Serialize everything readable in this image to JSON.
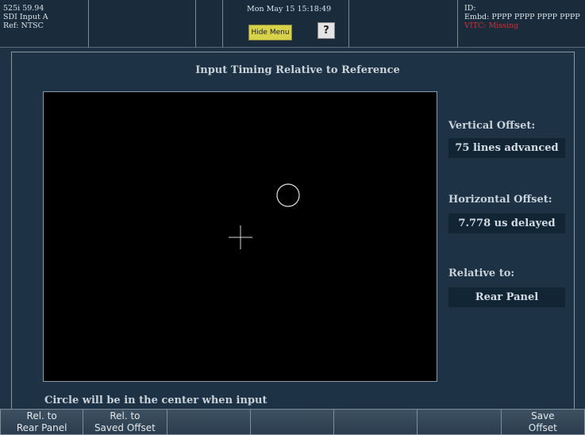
{
  "status_bar": {
    "format_line1": "525i 59.94",
    "format_line2": "SDI Input A",
    "format_line3": "Ref: NTSC",
    "datetime": "Mon May 15 15:18:49",
    "hide_menu_label": "Hide Menu",
    "help_label": "?",
    "id_label": "ID:",
    "embd_label": "Embd: PPPP PPPP PPPP PPPP",
    "vitc_label": "VITC:  Missing"
  },
  "panel": {
    "title": "Input Timing Relative to Reference",
    "vertical_offset_label": "Vertical Offset:",
    "vertical_offset_value": "75 lines advanced",
    "horizontal_offset_label": "Horizontal Offset:",
    "horizontal_offset_value": "7.778 us delayed",
    "relative_to_label": "Relative to:",
    "relative_to_value": "Rear Panel",
    "note": "Circle will be in the center when input"
  },
  "softkeys": [
    {
      "line1": "Rel. to",
      "line2": "Rear Panel"
    },
    {
      "line1": "Rel. to",
      "line2": "Saved Offset"
    },
    {
      "line1": "",
      "line2": ""
    },
    {
      "line1": "",
      "line2": ""
    },
    {
      "line1": "",
      "line2": ""
    },
    {
      "line1": "",
      "line2": ""
    },
    {
      "line1": "Save",
      "line2": "Offset"
    }
  ],
  "colors": {
    "background": "#1d3245",
    "hide_menu_button": "#d8d24a",
    "vitc_missing": "#e02a2a"
  }
}
